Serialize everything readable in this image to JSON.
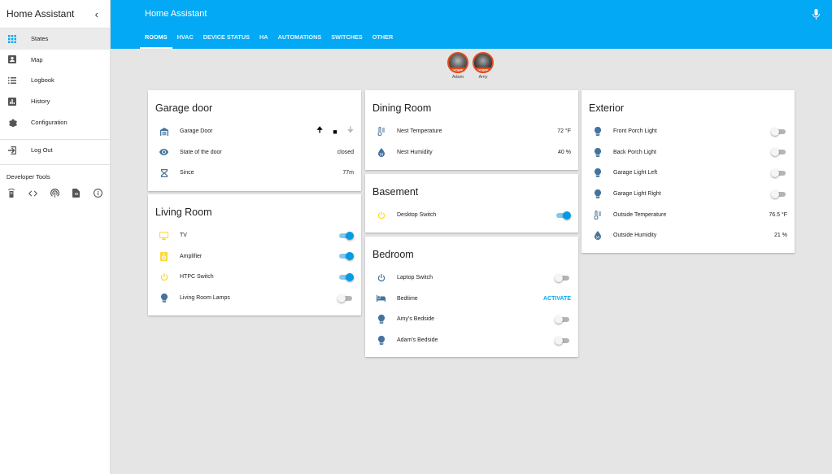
{
  "sidebar": {
    "title": "Home Assistant",
    "items": [
      {
        "label": "States"
      },
      {
        "label": "Map"
      },
      {
        "label": "Logbook"
      },
      {
        "label": "History"
      },
      {
        "label": "Configuration"
      },
      {
        "label": "Log Out"
      }
    ],
    "dev_tools_title": "Developer Tools"
  },
  "header": {
    "title": "Home Assistant",
    "tabs": [
      "ROOMS",
      "HVAC",
      "DEVICE STATUS",
      "HA",
      "AUTOMATIONS",
      "SWITCHES",
      "OTHER"
    ],
    "active_tab": "ROOMS"
  },
  "badges": [
    {
      "label": "HOME",
      "name": "Adam"
    },
    {
      "label": "HOME",
      "name": "Amy"
    }
  ],
  "cards": {
    "garage": {
      "title": "Garage door",
      "rows": [
        {
          "name": "Garage Door"
        },
        {
          "name": "State of the door",
          "value": "closed"
        },
        {
          "name": "Since",
          "value": "77m"
        }
      ]
    },
    "living": {
      "title": "Living Room",
      "rows": [
        {
          "name": "TV",
          "state": "on"
        },
        {
          "name": "Amplifier",
          "state": "on"
        },
        {
          "name": "HTPC Switch",
          "state": "on"
        },
        {
          "name": "Living Room Lamps",
          "state": "off"
        }
      ]
    },
    "dining": {
      "title": "Dining Room",
      "rows": [
        {
          "name": "Nest Temperature",
          "value": "72 °F"
        },
        {
          "name": "Nest Humidity",
          "value": "40 %"
        }
      ]
    },
    "basement": {
      "title": "Basement",
      "rows": [
        {
          "name": "Desktop Switch",
          "state": "on"
        }
      ]
    },
    "bedroom": {
      "title": "Bedroom",
      "rows": [
        {
          "name": "Laptop Switch",
          "state": "off"
        },
        {
          "name": "Bedtime",
          "action": "ACTIVATE"
        },
        {
          "name": "Amy's Bedside",
          "state": "off"
        },
        {
          "name": "Adam's Bedside",
          "state": "off"
        }
      ]
    },
    "exterior": {
      "title": "Exterior",
      "rows": [
        {
          "name": "Front Porch Light",
          "state": "off"
        },
        {
          "name": "Back Porch Light",
          "state": "off"
        },
        {
          "name": "Garage Light Left",
          "state": "off"
        },
        {
          "name": "Garage Light Right",
          "state": "off"
        },
        {
          "name": "Outside Temperature",
          "value": "76.5 °F"
        },
        {
          "name": "Outside Humidity",
          "value": "21 %"
        }
      ]
    }
  },
  "colors": {
    "primary": "#03a9f4",
    "icon": "#44739e",
    "icon_active": "#fdd835",
    "badge": "#df4c1e"
  }
}
